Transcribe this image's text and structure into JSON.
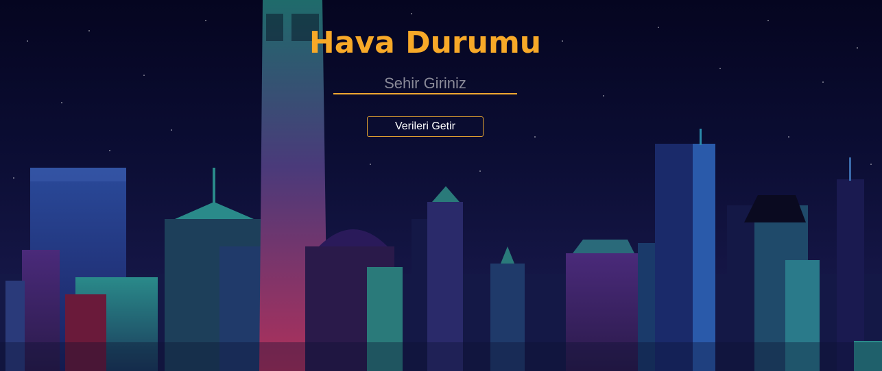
{
  "header": {
    "title": "Hava Durumu"
  },
  "search": {
    "value": "",
    "placeholder": "Sehir Giriniz"
  },
  "actions": {
    "fetch_label": "Verileri Getir"
  },
  "colors": {
    "accent": "#f7a928",
    "button_border": "#e0a030",
    "background": "#0b0d33"
  }
}
